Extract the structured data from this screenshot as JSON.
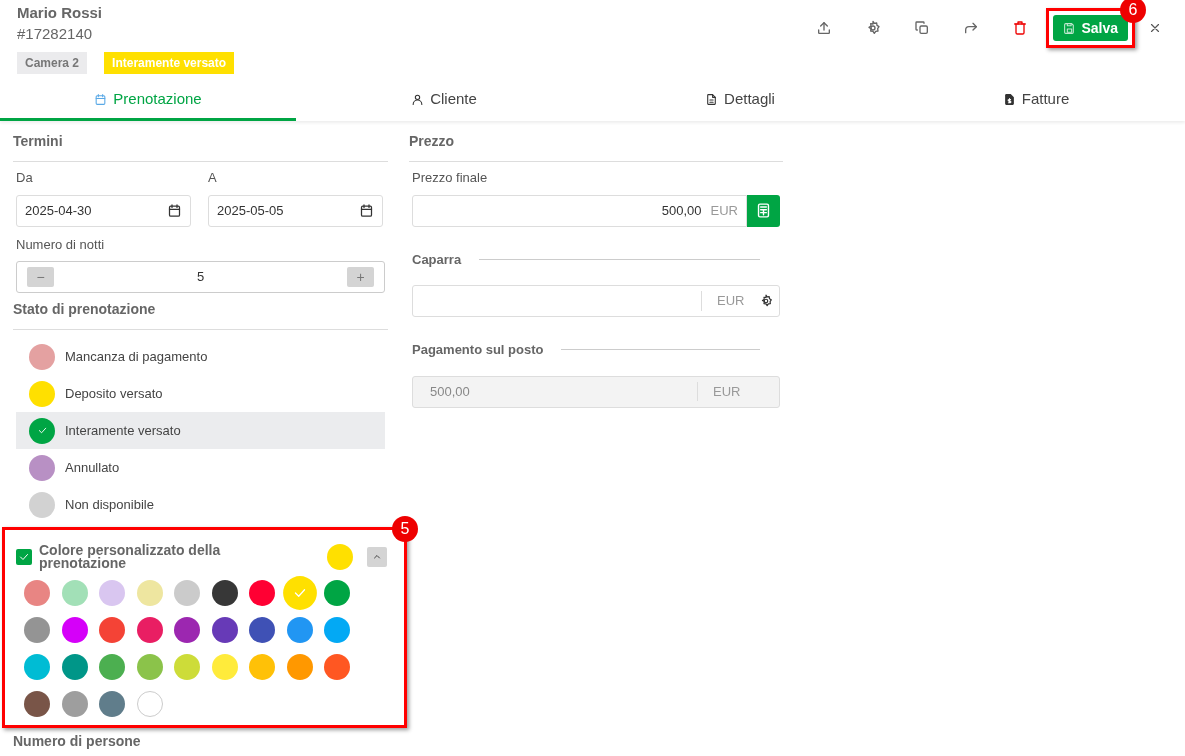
{
  "header": {
    "name": "Mario Rossi",
    "id": "#17282140",
    "tags": [
      {
        "label": "Camera 2",
        "kind": "room"
      },
      {
        "label": "Interamente versato",
        "kind": "status",
        "color": "#ffe000"
      }
    ]
  },
  "toolbar": {
    "save_button": {
      "label": "Salva",
      "annotation": "6"
    }
  },
  "tabs": [
    {
      "label": "Prenotazione",
      "selected": true
    },
    {
      "label": "Cliente",
      "selected": false
    },
    {
      "label": "Dettagli",
      "selected": false
    },
    {
      "label": "Fatture",
      "selected": false
    }
  ],
  "termini": {
    "title": "Termini",
    "from": {
      "label": "Da",
      "value": "2025-04-30"
    },
    "to": {
      "label": "A",
      "value": "2025-05-05"
    },
    "nights": {
      "label": "Numero di notti",
      "value": "5",
      "minus": "−",
      "plus": "+"
    }
  },
  "stato": {
    "title": "Stato di prenotazione",
    "items": [
      {
        "label": "Mancanza di pagamento",
        "color": "#e4a1a1",
        "selected": false
      },
      {
        "label": "Deposito versato",
        "color": "#ffe000",
        "selected": false
      },
      {
        "label": "Interamente versato",
        "color": "#00a544",
        "selected": true
      },
      {
        "label": "Annullato",
        "color": "#b890c4",
        "selected": false
      },
      {
        "label": "Non disponibile",
        "color": "#d2d2d2",
        "selected": false
      }
    ]
  },
  "custom_color": {
    "label": "Colore personalizzato della prenotazione",
    "checked": true,
    "expanded": true,
    "color": "#ffe000",
    "annotation": "5",
    "swatches": [
      {
        "color": "#e88583",
        "selected": false
      },
      {
        "color": "#a2e0b7",
        "selected": false
      },
      {
        "color": "#d9c6f0",
        "selected": false
      },
      {
        "color": "#eee6a0",
        "selected": false
      },
      {
        "color": "#cbcbcb",
        "selected": false
      },
      {
        "color": "#373737",
        "selected": false
      },
      {
        "color": "#ff0033",
        "selected": false
      },
      {
        "color": "#ffe000",
        "selected": true
      },
      {
        "color": "#00a544",
        "selected": false
      },
      {
        "color": "#949494",
        "selected": false
      },
      {
        "color": "#d500f9",
        "selected": false
      },
      {
        "color": "#f44336",
        "selected": false
      },
      {
        "color": "#e91e63",
        "selected": false
      },
      {
        "color": "#9c27b0",
        "selected": false
      },
      {
        "color": "#673ab7",
        "selected": false
      },
      {
        "color": "#3f51b5",
        "selected": false
      },
      {
        "color": "#2196f3",
        "selected": false
      },
      {
        "color": "#03a9f4",
        "selected": false
      },
      {
        "color": "#00bcd4",
        "selected": false
      },
      {
        "color": "#009688",
        "selected": false
      },
      {
        "color": "#4caf50",
        "selected": false
      },
      {
        "color": "#8bc34a",
        "selected": false
      },
      {
        "color": "#cddc39",
        "selected": false
      },
      {
        "color": "#ffeb3b",
        "selected": false
      },
      {
        "color": "#ffc107",
        "selected": false
      },
      {
        "color": "#ff9800",
        "selected": false
      },
      {
        "color": "#ff5722",
        "selected": false
      },
      {
        "color": "#795548",
        "selected": false
      },
      {
        "color": "#9e9e9e",
        "selected": false
      },
      {
        "color": "#607d8b",
        "selected": false
      },
      {
        "color": "#ffffff",
        "selected": false
      }
    ]
  },
  "persone": {
    "title": "Numero di persone"
  },
  "prezzo": {
    "title": "Prezzo",
    "final": {
      "label": "Prezzo finale",
      "value": "500,00",
      "currency": "EUR"
    },
    "deposit": {
      "label": "Caparra",
      "currency": "EUR"
    },
    "on_site": {
      "label": "Pagamento sul posto",
      "value": "500,00",
      "currency": "EUR",
      "disabled": true
    }
  }
}
